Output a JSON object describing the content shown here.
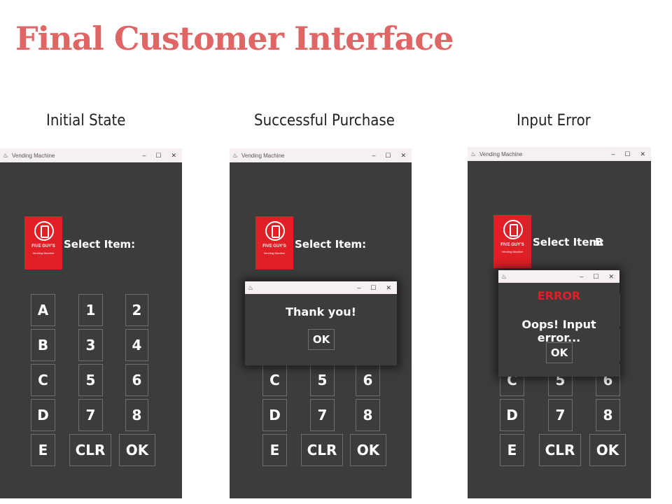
{
  "page_title": "Final Customer Interface",
  "captions": [
    "Initial State",
    "Successful Purchase",
    "Input Error"
  ],
  "window": {
    "title": "Vending Machine",
    "minimize": "–",
    "maximize": "☐",
    "close": "✕"
  },
  "logo": {
    "brand": "FIVE GUY'S",
    "subtitle": "Vending Machine"
  },
  "select_label": "Select Item:",
  "error_input_value": "B",
  "keys": [
    "A",
    "1",
    "2",
    "B",
    "3",
    "4",
    "C",
    "5",
    "6",
    "D",
    "7",
    "8",
    "E",
    "CLR",
    "OK"
  ],
  "success_dialog": {
    "message": "Thank you!",
    "ok_label": "OK"
  },
  "error_dialog": {
    "heading": "ERROR",
    "message": "Oops! Input error...",
    "ok_label": "OK"
  },
  "colors": {
    "title": "#e06666",
    "panel": "#3c3c3c",
    "logo": "#e01f26",
    "error": "#e01f26"
  }
}
